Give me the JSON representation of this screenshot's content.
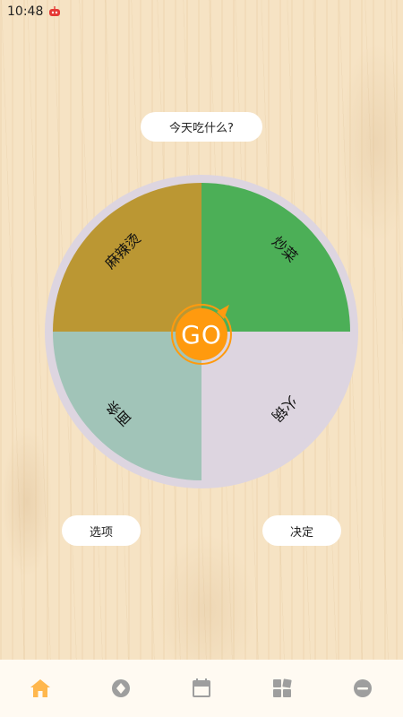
{
  "status_bar": {
    "time": "10:48",
    "app_icon": "robot-icon"
  },
  "title": "今天吃什么?",
  "wheel": {
    "sectors": [
      {
        "label": "炒菜",
        "color": "#4caf57"
      },
      {
        "label": "火锅",
        "color": "#ddd5e0"
      },
      {
        "label": "面条",
        "color": "#a1c4b8"
      },
      {
        "label": "麻辣烫",
        "color": "#bb9733"
      }
    ],
    "rim_color": "#ddd5e0",
    "go_label": "GO",
    "go_color": "#ff9a0e"
  },
  "buttons": {
    "options": "选项",
    "decide": "决定"
  },
  "bottom_nav": [
    {
      "name": "home",
      "icon": "home-icon",
      "active": true,
      "active_color": "#ffb74d"
    },
    {
      "name": "discover",
      "icon": "compass-icon",
      "active": false
    },
    {
      "name": "calendar",
      "icon": "calendar-icon",
      "active": false
    },
    {
      "name": "apps",
      "icon": "grid-icon",
      "active": false
    },
    {
      "name": "profile",
      "icon": "profile-icon",
      "active": false
    }
  ]
}
